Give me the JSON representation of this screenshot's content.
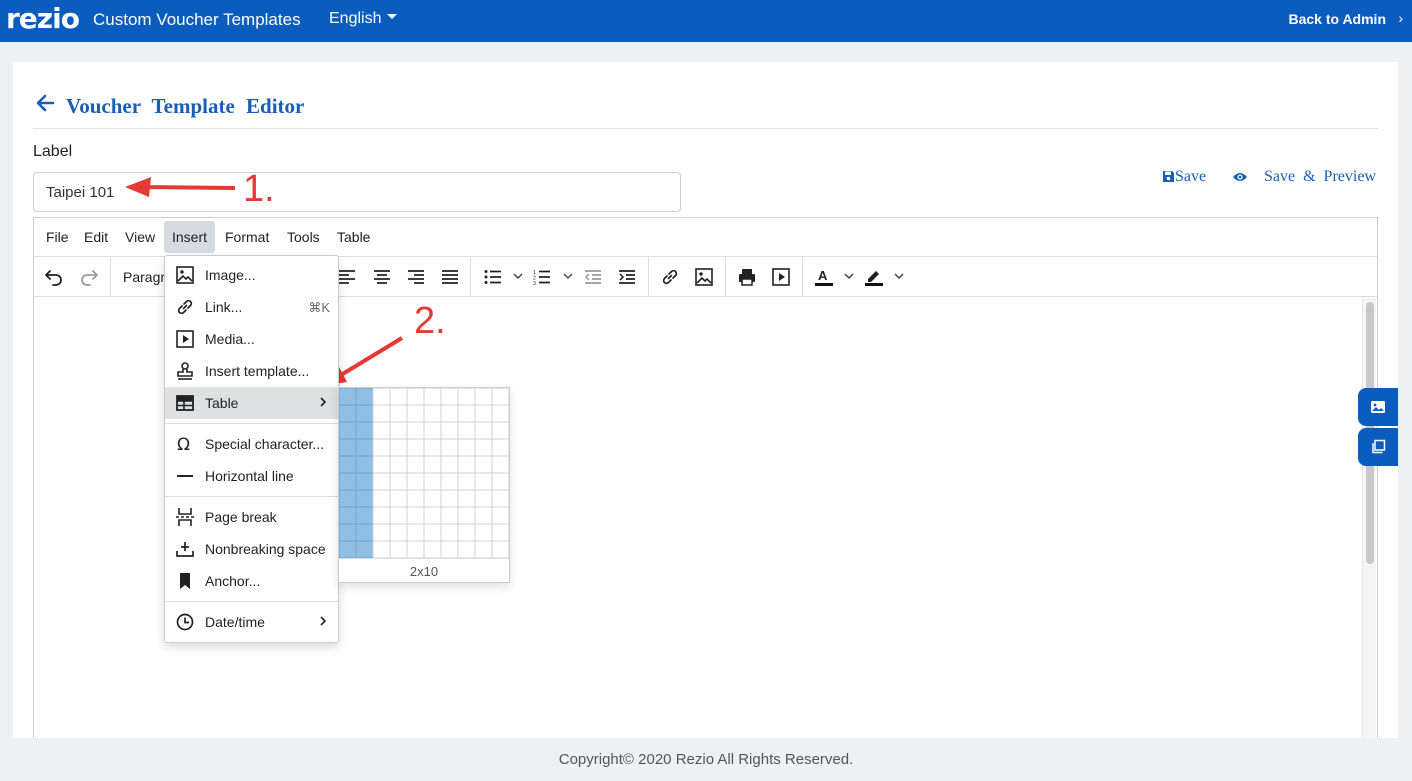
{
  "topbar": {
    "logo": "rezio",
    "title": "Custom Voucher Templates",
    "language": "English",
    "back_label": "Back to Admin",
    "back_chevron": "›"
  },
  "page": {
    "title": "Voucher Template Editor",
    "label": "Label",
    "label_value": "Taipei 101",
    "save_label": "Save",
    "preview_label": "Save & Preview"
  },
  "annotations": {
    "step1": "1.",
    "step2": "2."
  },
  "editor": {
    "menu": [
      "File",
      "Edit",
      "View",
      "Insert",
      "Format",
      "Tools",
      "Table"
    ],
    "active_menu": "Insert",
    "block_format": "Paragr"
  },
  "insert_menu": {
    "items": [
      {
        "label": "Image...",
        "icon": "image-icon"
      },
      {
        "label": "Link...",
        "icon": "link-icon",
        "shortcut": "⌘K"
      },
      {
        "label": "Media...",
        "icon": "media-icon"
      },
      {
        "label": "Insert template...",
        "icon": "template-icon"
      },
      {
        "label": "Table",
        "icon": "table-icon",
        "submenu": true
      },
      {
        "label": "Special character...",
        "icon": "omega-icon"
      },
      {
        "label": "Horizontal line",
        "icon": "horizontal-line-icon"
      },
      {
        "label": "Page break",
        "icon": "page-break-icon"
      },
      {
        "label": "Nonbreaking space",
        "icon": "nonbreaking-space-icon"
      },
      {
        "label": "Anchor...",
        "icon": "bookmark-icon"
      },
      {
        "label": "Date/time",
        "icon": "clock-icon",
        "submenu": true
      }
    ],
    "hovered": "Table"
  },
  "table_grid": {
    "selection_label": "2x10",
    "selected_cols": 2,
    "selected_rows": 10,
    "grid_cols": 10,
    "grid_rows": 10
  },
  "colors": {
    "brand_blue": "#0b5cbf",
    "title_blue": "#1a5eb5",
    "annotation_red": "#e33a35",
    "grid_selected": "#8fbfe3"
  },
  "footer": {
    "copyright": "Copyright© 2020 Rezio All Rights Reserved."
  }
}
